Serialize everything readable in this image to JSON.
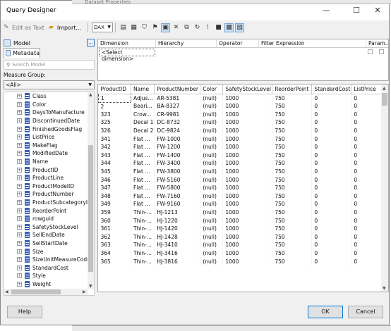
{
  "background_window": {
    "title": "Dataset Properties"
  },
  "window": {
    "title": "Query Designer",
    "minimize": "—",
    "maximize": "☐",
    "close": "✕"
  },
  "toolbar": {
    "edit_as_text": "Edit as Text",
    "import": "Import...",
    "language": "DAX"
  },
  "left": {
    "model_label": "Model",
    "ellipsis": "...",
    "metadata_tab": "Metadata",
    "search_placeholder": "Search Model",
    "measure_group_label": "Measure Group:",
    "measure_group_value": "<All>",
    "tree_items": [
      "Class",
      "Color",
      "DaysToManufacture",
      "DiscontinuedDate",
      "FinishedGoodsFlag",
      "ListPrice",
      "MakeFlag",
      "ModifiedDate",
      "Name",
      "ProductID",
      "ProductLine",
      "ProductModelID",
      "ProductNumber",
      "ProductSubcategoryID",
      "ReorderPoint",
      "rowguid",
      "SafetyStockLevel",
      "SellEndDate",
      "SellStartDate",
      "Size",
      "SizeUnitMeasureCode",
      "StandardCost",
      "Style",
      "Weight"
    ]
  },
  "filter": {
    "headers": [
      "Dimension",
      "Hierarchy",
      "Operator",
      "Filter Expression",
      "Param..."
    ],
    "select_dimension": "<Select dimension>"
  },
  "grid": {
    "columns": [
      "ProductID",
      "Name",
      "ProductNumber",
      "Color",
      "SafetyStockLevel",
      "ReorderPoint",
      "StandardCost",
      "ListPrice"
    ],
    "rows": [
      [
        "1",
        "Adjus...",
        "AR-5381",
        "(null)",
        "1000",
        "750",
        "0",
        "0"
      ],
      [
        "2",
        "Beari...",
        "BA-8327",
        "(null)",
        "1000",
        "750",
        "0",
        "0"
      ],
      [
        "323",
        "Crow...",
        "CR-9981",
        "(null)",
        "1000",
        "750",
        "0",
        "0"
      ],
      [
        "325",
        "Decal 1",
        "DC-8732",
        "(null)",
        "1000",
        "750",
        "0",
        "0"
      ],
      [
        "326",
        "Decal 2",
        "DC-9824",
        "(null)",
        "1000",
        "750",
        "0",
        "0"
      ],
      [
        "341",
        "Flat ...",
        "FW-1000",
        "(null)",
        "1000",
        "750",
        "0",
        "0"
      ],
      [
        "342",
        "Flat ...",
        "FW-1200",
        "(null)",
        "1000",
        "750",
        "0",
        "0"
      ],
      [
        "343",
        "Flat ...",
        "FW-1400",
        "(null)",
        "1000",
        "750",
        "0",
        "0"
      ],
      [
        "344",
        "Flat ...",
        "FW-3400",
        "(null)",
        "1000",
        "750",
        "0",
        "0"
      ],
      [
        "345",
        "Flat ...",
        "FW-3800",
        "(null)",
        "1000",
        "750",
        "0",
        "0"
      ],
      [
        "346",
        "Flat ...",
        "FW-5160",
        "(null)",
        "1000",
        "750",
        "0",
        "0"
      ],
      [
        "347",
        "Flat ...",
        "FW-5800",
        "(null)",
        "1000",
        "750",
        "0",
        "0"
      ],
      [
        "348",
        "Flat ...",
        "FW-7160",
        "(null)",
        "1000",
        "750",
        "0",
        "0"
      ],
      [
        "349",
        "Flat ...",
        "FW-9160",
        "(null)",
        "1000",
        "750",
        "0",
        "0"
      ],
      [
        "359",
        "Thin-...",
        "HJ-1213",
        "(null)",
        "1000",
        "750",
        "0",
        "0"
      ],
      [
        "360",
        "Thin-...",
        "HJ-1220",
        "(null)",
        "1000",
        "750",
        "0",
        "0"
      ],
      [
        "361",
        "Thin-...",
        "HJ-1420",
        "(null)",
        "1000",
        "750",
        "0",
        "0"
      ],
      [
        "362",
        "Thin-...",
        "HJ-1428",
        "(null)",
        "1000",
        "750",
        "0",
        "0"
      ],
      [
        "363",
        "Thin-...",
        "HJ-3410",
        "(null)",
        "1000",
        "750",
        "0",
        "0"
      ],
      [
        "364",
        "Thin-...",
        "HJ-3416",
        "(null)",
        "1000",
        "750",
        "0",
        "0"
      ],
      [
        "365",
        "Thin-...",
        "HJ-3816",
        "(null)",
        "1000",
        "750",
        "0",
        "0"
      ]
    ]
  },
  "buttons": {
    "help": "Help",
    "ok": "OK",
    "cancel": "Cancel"
  }
}
